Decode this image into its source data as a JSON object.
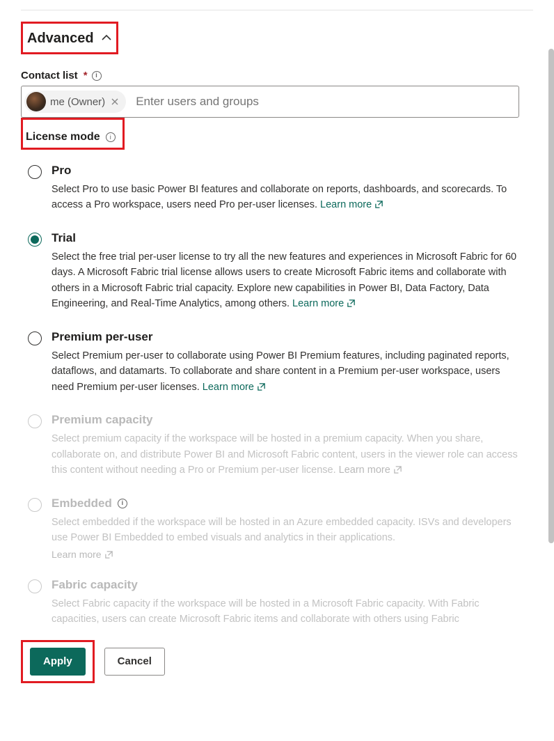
{
  "advanced": {
    "title": "Advanced"
  },
  "contact": {
    "label": "Contact list",
    "chip_label": "me (Owner)",
    "placeholder": "Enter users and groups"
  },
  "license": {
    "label": "License mode",
    "learn_more": "Learn more",
    "options": [
      {
        "key": "pro",
        "title": "Pro",
        "desc": "Select Pro to use basic Power BI features and collaborate on reports, dashboards, and scorecards. To access a Pro workspace, users need Pro per-user licenses.",
        "selected": false,
        "disabled": false
      },
      {
        "key": "trial",
        "title": "Trial",
        "desc": "Select the free trial per-user license to try all the new features and experiences in Microsoft Fabric for 60 days. A Microsoft Fabric trial license allows users to create Microsoft Fabric items and collaborate with others in a Microsoft Fabric trial capacity. Explore new capabilities in Power BI, Data Factory, Data Engineering, and Real-Time Analytics, among others.",
        "selected": true,
        "disabled": false
      },
      {
        "key": "ppu",
        "title": "Premium per-user",
        "desc": "Select Premium per-user to collaborate using Power BI Premium features, including paginated reports, dataflows, and datamarts. To collaborate and share content in a Premium per-user workspace, users need Premium per-user licenses.",
        "selected": false,
        "disabled": false
      },
      {
        "key": "premcap",
        "title": "Premium capacity",
        "desc": "Select premium capacity if the workspace will be hosted in a premium capacity. When you share, collaborate on, and distribute Power BI and Microsoft Fabric content, users in the viewer role can access this content without needing a Pro or Premium per-user license.",
        "selected": false,
        "disabled": true
      },
      {
        "key": "embedded",
        "title": "Embedded",
        "desc": "Select embedded if the workspace will be hosted in an Azure embedded capacity. ISVs and developers use Power BI Embedded to embed visuals and analytics in their applications.",
        "selected": false,
        "disabled": true,
        "info": true
      },
      {
        "key": "fabric",
        "title": "Fabric capacity",
        "desc": "Select Fabric capacity if the workspace will be hosted in a Microsoft Fabric capacity. With Fabric capacities, users can create Microsoft Fabric items and collaborate with others using Fabric",
        "selected": false,
        "disabled": true
      }
    ]
  },
  "footer": {
    "apply": "Apply",
    "cancel": "Cancel"
  }
}
